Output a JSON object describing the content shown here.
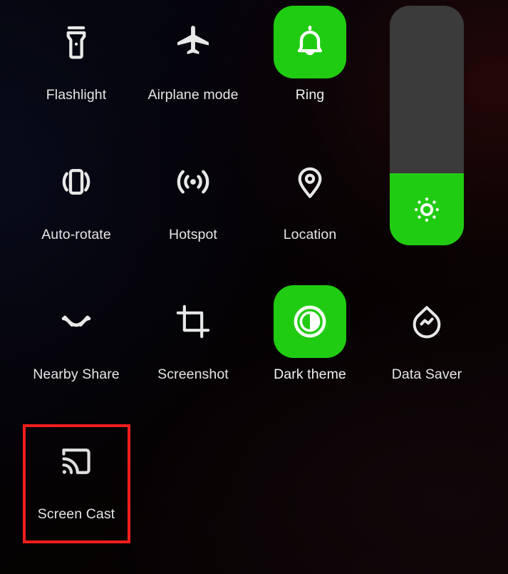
{
  "screen": {
    "name": "Quick Settings panel",
    "background_color": "#050309",
    "accent_on_color": "#20cc12",
    "label_color": "#e6e6e6",
    "highlight_color": "#f21d1d"
  },
  "brightness_slider": {
    "name": "Brightness",
    "icon": "brightness-icon",
    "level_percent": 30,
    "track_color": "#3b3b3b",
    "fill_color": "#20cc12"
  },
  "tiles": [
    {
      "label": "Flashlight",
      "icon": "flashlight-icon",
      "state": "off",
      "row": 1,
      "col": 1
    },
    {
      "label": "Airplane mode",
      "icon": "airplane-icon",
      "state": "off",
      "row": 1,
      "col": 2
    },
    {
      "label": "Ring",
      "icon": "bell-icon",
      "state": "on",
      "row": 1,
      "col": 3
    },
    {
      "label": "Auto-rotate",
      "icon": "auto-rotate-icon",
      "state": "off",
      "row": 2,
      "col": 1
    },
    {
      "label": "Hotspot",
      "icon": "hotspot-icon",
      "state": "off",
      "row": 2,
      "col": 2
    },
    {
      "label": "Location",
      "icon": "location-pin-icon",
      "state": "off",
      "row": 2,
      "col": 3
    },
    {
      "label": "Nearby Share",
      "icon": "nearby-share-icon",
      "state": "off",
      "row": 3,
      "col": 1
    },
    {
      "label": "Screenshot",
      "icon": "screenshot-icon",
      "state": "off",
      "row": 3,
      "col": 2
    },
    {
      "label": "Dark theme",
      "icon": "dark-theme-icon",
      "state": "on",
      "row": 3,
      "col": 3
    },
    {
      "label": "Data Saver",
      "icon": "data-saver-icon",
      "state": "off",
      "row": 3,
      "col": 4
    },
    {
      "label": "Screen Cast",
      "icon": "screen-cast-icon",
      "state": "off",
      "row": 4,
      "col": 1
    }
  ],
  "annotation": {
    "target_label": "Screen Cast",
    "shape": "rectangle",
    "color": "#f21d1d"
  }
}
